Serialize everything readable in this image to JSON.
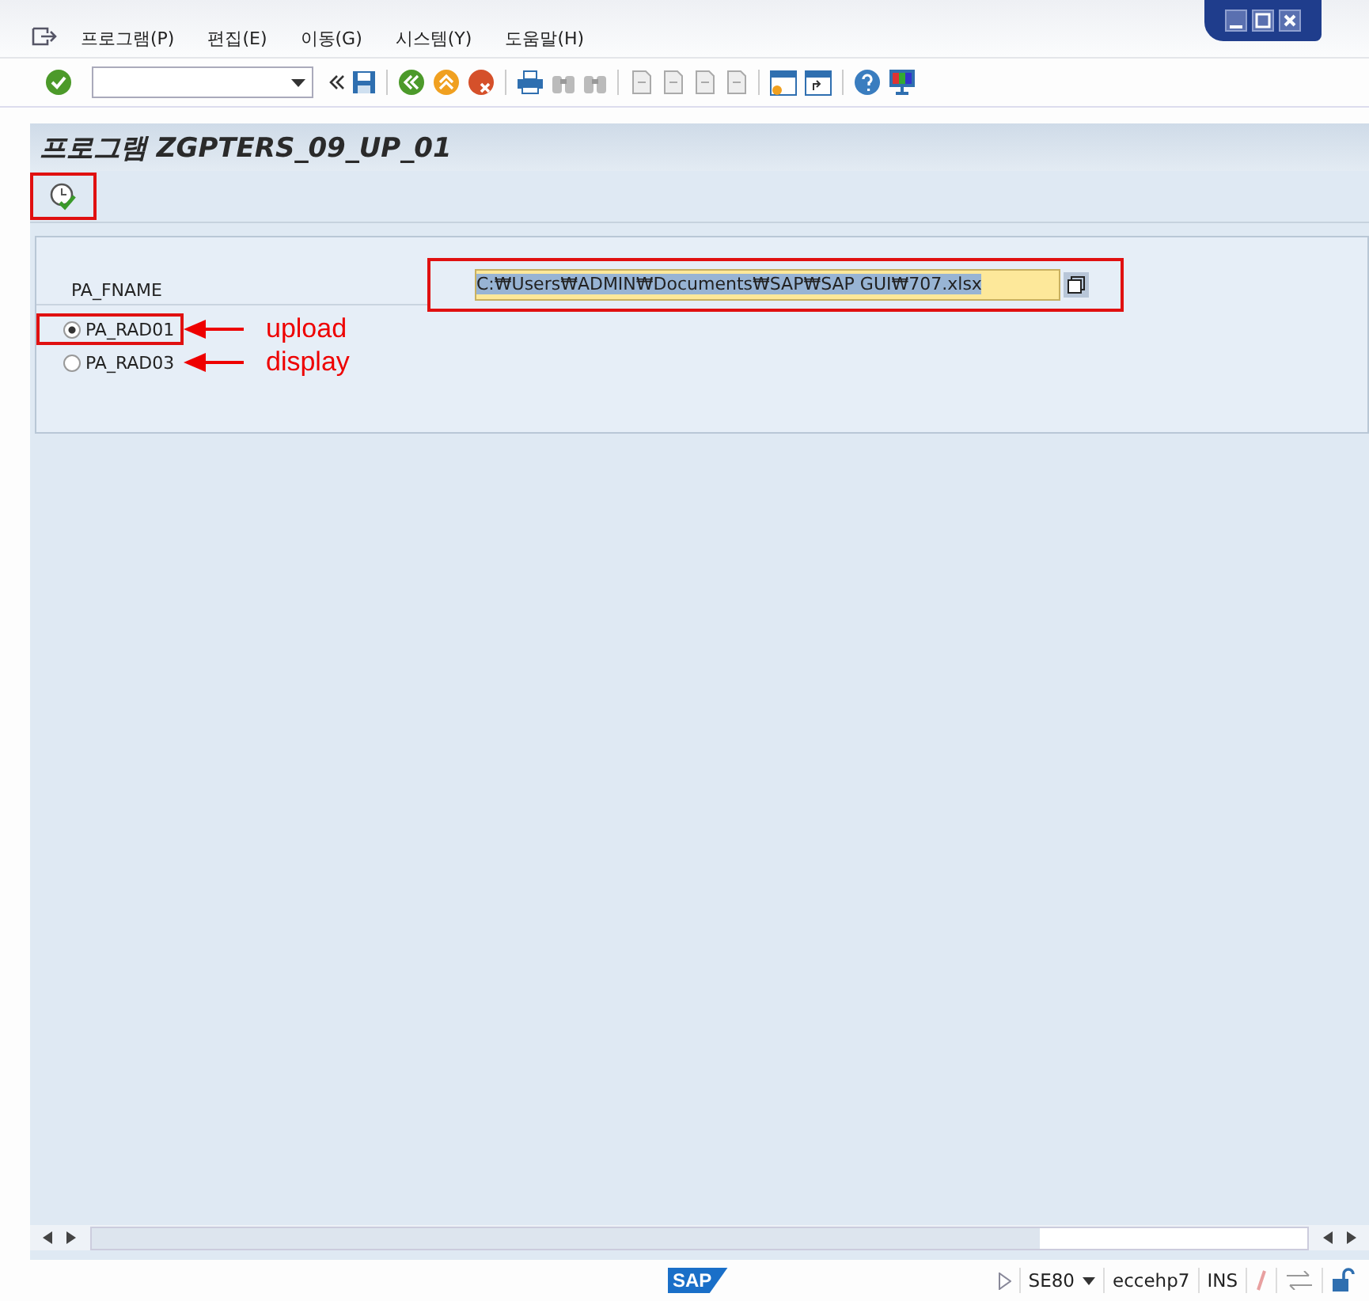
{
  "menu": [
    {
      "label": "프로그램(P)"
    },
    {
      "label": "편집(E)"
    },
    {
      "label": "이동(G)"
    },
    {
      "label": "시스템(Y)"
    },
    {
      "label": "도움말(H)"
    }
  ],
  "screen_title": "프로그램 ZGPTERS_09_UP_01",
  "execute_button": {
    "highlighted": true
  },
  "fields": [
    {
      "label": "PA_FNAME",
      "value": "C:₩Users₩ADMIN₩Documents₩SAP₩SAP GUI₩707.xlsx",
      "highlighted": true
    }
  ],
  "radios": [
    {
      "label": "PA_RAD01",
      "selected": true,
      "highlighted": true,
      "annotation": "upload"
    },
    {
      "label": "PA_RAD03",
      "selected": false,
      "highlighted": false,
      "annotation": "display"
    }
  ],
  "logo": "SAP",
  "status_bar": {
    "transaction": "SE80",
    "system": "eccehp7",
    "mode": "INS"
  }
}
